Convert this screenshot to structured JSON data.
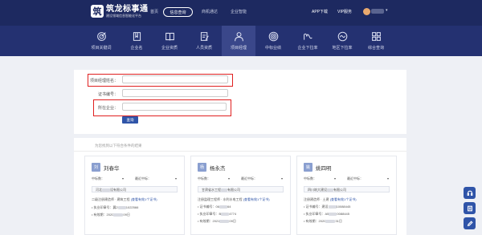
{
  "header": {
    "logo_mark": "筑",
    "logo_title": "筑龙标事通",
    "logo_subtitle": "建设领域信息智能化平台",
    "nav": [
      "首页",
      "信息查询",
      "商机通达",
      "企业智能"
    ],
    "active_nav": "信息查询",
    "app_download": "APP下载",
    "vip_service": "VIP服务",
    "user_caret": "▾"
  },
  "categories": [
    {
      "label": "项目关键词",
      "icon": "target-icon"
    },
    {
      "label": "企业名",
      "icon": "bookmark-icon"
    },
    {
      "label": "企业资质",
      "icon": "book-icon"
    },
    {
      "label": "人员资质",
      "icon": "document-pen-icon"
    },
    {
      "label": "项目经理",
      "icon": "person-icon",
      "active": true
    },
    {
      "label": "中标业绩",
      "icon": "concentric-circles-icon"
    },
    {
      "label": "企业下拉率",
      "icon": "m-wave-icon"
    },
    {
      "label": "地区下拉率",
      "icon": "wave-circle-icon"
    },
    {
      "label": "综合查询",
      "icon": "grid-icon"
    }
  ],
  "form": {
    "name_label": "项目经理姓名：",
    "cert_label": "证书编号：",
    "company_label": "所在企业：",
    "query_button": "查询"
  },
  "results": {
    "title": "为您找到以下符合条件的结果",
    "middle_label": "中标数：",
    "recent_label": "最近中标：",
    "caret": "▾",
    "cards": [
      {
        "avatar_char": "刘",
        "name": "刘春华",
        "company_prefix": "河北",
        "company_suffix": "设有限公司",
        "cert_type": "二级注册建造师 · 建筑工程",
        "cert_link": "(查看有效1个证书)",
        "exec_label": "执业印章号：",
        "exec_prefix": "冀2",
        "exec_suffix": "1022566",
        "valid_label": "有效期：",
        "valid_prefix": "2020",
        "valid_suffix": "09日"
      },
      {
        "avatar_char": "杨",
        "name": "杨永杰",
        "company_prefix": "甘肃省水工程",
        "company_suffix": "有限公司",
        "cert_type": "注册监理工程师 · 水利水电工程",
        "cert_link": "(查看有效1个证书)",
        "exec_label": "证书编号：",
        "exec_prefix": "06",
        "exec_suffix": "64",
        "exec2_label": "执业印章号：",
        "exec2_prefix": "B",
        "exec2_suffix": "4774",
        "valid_label": "有效期：",
        "valid_prefix": "2021",
        "valid_suffix": "09日"
      },
      {
        "avatar_char": "姚",
        "name": "姚四明",
        "company_prefix": "四川筑大建设",
        "company_suffix": "有限公司",
        "cert_type": "注册建造师 · 土建",
        "cert_link": "(查看有效1个证书)",
        "exec_label": "证书编号：",
        "exec_prefix": "建设",
        "exec_suffix": "10088445",
        "exec2_label": "执业印章号：",
        "exec2_prefix": "A5",
        "exec2_suffix": "0088445",
        "valid_label": "有效期：",
        "valid_prefix": "2020",
        "valid_suffix": "31日"
      }
    ]
  },
  "colors": {
    "topbar": "#1d2960",
    "catbar": "#243171",
    "accent": "#2f54a8",
    "highlight": "#e02020"
  }
}
